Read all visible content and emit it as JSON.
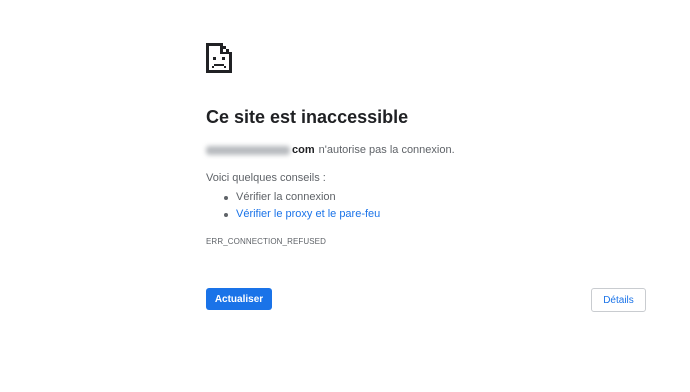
{
  "error_page": {
    "icon": "sad-page-icon",
    "title": "Ce site est inaccessible",
    "host_redacted": "xxxxxxxxxxxx",
    "host_suffix": "com",
    "description": "n'autorise pas la connexion.",
    "tips_title": "Voici quelques conseils :",
    "tips": [
      {
        "label": "Vérifier la connexion",
        "is_link": false
      },
      {
        "label": "Vérifier le proxy et le pare-feu",
        "is_link": true
      }
    ],
    "error_code": "ERR_CONNECTION_REFUSED",
    "reload_label": "Actualiser",
    "details_label": "Détails"
  },
  "colors": {
    "accent": "#1a73e8",
    "text_primary": "#202124",
    "text_secondary": "#5f6368"
  }
}
